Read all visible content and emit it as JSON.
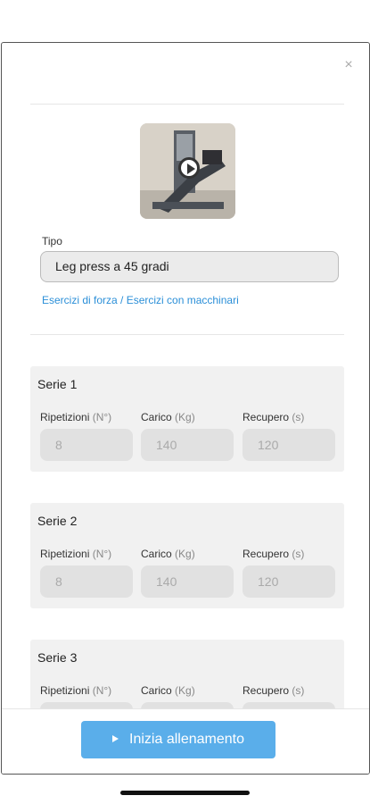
{
  "header": {
    "close_icon": "close-icon"
  },
  "exercise": {
    "thumbnail_icon": "play-icon",
    "type_label": "Tipo",
    "type_value": "Leg press a 45 gradi",
    "category": "Esercizi di forza / Esercizi con macchinari"
  },
  "series": [
    {
      "title": "Serie 1",
      "reps_label": "Ripetizioni",
      "reps_unit": "(N°)",
      "reps_value": "8",
      "load_label": "Carico",
      "load_unit": "(Kg)",
      "load_value": "140",
      "rest_label": "Recupero",
      "rest_unit": "(s)",
      "rest_value": "120"
    },
    {
      "title": "Serie 2",
      "reps_label": "Ripetizioni",
      "reps_unit": "(N°)",
      "reps_value": "8",
      "load_label": "Carico",
      "load_unit": "(Kg)",
      "load_value": "140",
      "rest_label": "Recupero",
      "rest_unit": "(s)",
      "rest_value": "120"
    },
    {
      "title": "Serie 3",
      "reps_label": "Ripetizioni",
      "reps_unit": "(N°)",
      "reps_value": "",
      "load_label": "Carico",
      "load_unit": "(Kg)",
      "load_value": "",
      "rest_label": "Recupero",
      "rest_unit": "(s)",
      "rest_value": ""
    }
  ],
  "footer": {
    "start_label": "Inizia allenamento"
  },
  "colors": {
    "accent": "#5aaeea",
    "link": "#2b8fd8"
  }
}
